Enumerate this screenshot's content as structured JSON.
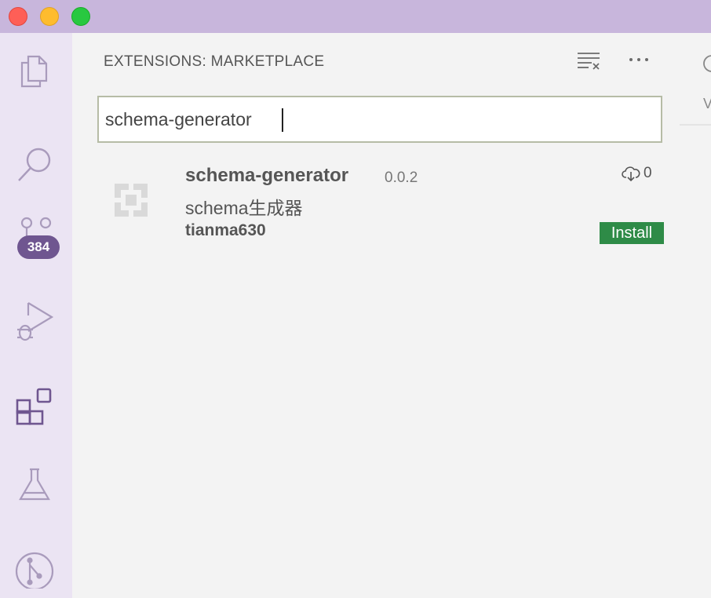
{
  "window": {
    "controls": [
      "close",
      "minimize",
      "maximize"
    ]
  },
  "activity_bar": {
    "items": [
      {
        "icon": "files-icon"
      },
      {
        "icon": "search-icon"
      },
      {
        "icon": "source-control-icon",
        "badge": "384"
      },
      {
        "icon": "run-debug-icon"
      },
      {
        "icon": "extensions-icon",
        "active": true
      },
      {
        "icon": "testing-icon"
      },
      {
        "icon": "git-graph-icon"
      }
    ]
  },
  "sidebar": {
    "title": "EXTENSIONS: MARKETPLACE",
    "actions": [
      "clear-results-icon",
      "more-actions-icon"
    ],
    "search": {
      "value": "schema-generator"
    },
    "results": [
      {
        "name": "schema-generator",
        "version": "0.0.2",
        "description": "schema生成器",
        "publisher": "tianma630",
        "downloads": "0",
        "install_label": "Install"
      }
    ]
  },
  "editor_edge": {
    "partial_text": "V"
  },
  "colors": {
    "title_bar": "#c8b6dc",
    "activity_bar": "#ebe4f3",
    "badge": "#6f5690",
    "install_button": "#2e8b47",
    "sidebar_bg": "#f3f3f3"
  }
}
